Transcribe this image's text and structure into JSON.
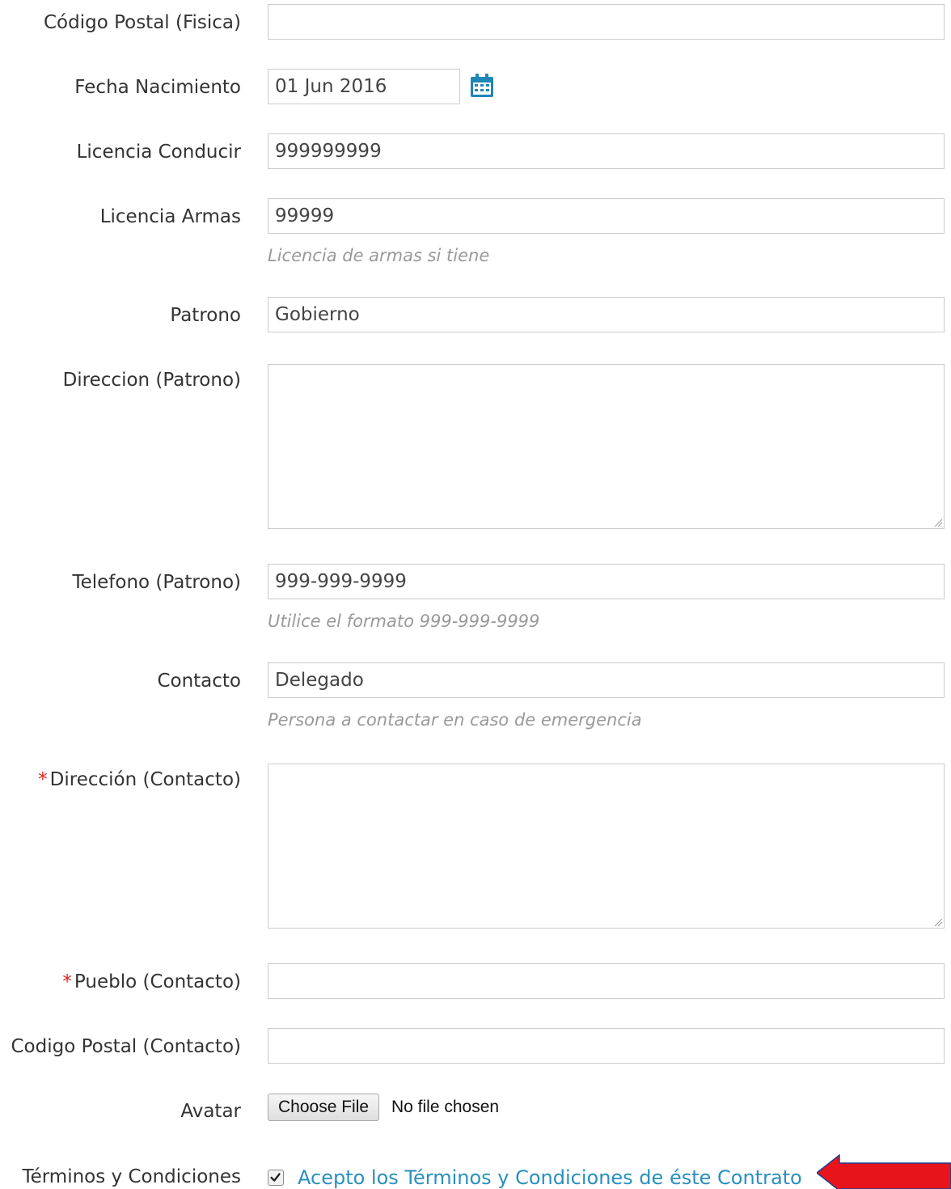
{
  "form": {
    "codigo_postal_fisica": {
      "label": "Código Postal (Fisica)",
      "value": ""
    },
    "fecha_nacimiento": {
      "label": "Fecha Nacimiento",
      "value": "01 Jun 2016",
      "icon": "calendar-icon"
    },
    "licencia_conducir": {
      "label": "Licencia Conducir",
      "value": "999999999"
    },
    "licencia_armas": {
      "label": "Licencia Armas",
      "value": "99999",
      "help": "Licencia de armas si tiene"
    },
    "patrono": {
      "label": "Patrono",
      "value": "Gobierno"
    },
    "direccion_patrono": {
      "label": "Direccion (Patrono)",
      "value": ""
    },
    "telefono_patrono": {
      "label": "Telefono (Patrono)",
      "value": "999-999-9999",
      "help": "Utilice el formato 999-999-9999"
    },
    "contacto": {
      "label": "Contacto",
      "value": "Delegado",
      "help": "Persona a contactar en caso de emergencia"
    },
    "direccion_contacto": {
      "label": "Dirección (Contacto)",
      "required_mark": "*",
      "value": ""
    },
    "pueblo_contacto": {
      "label": "Pueblo (Contacto)",
      "required_mark": "*",
      "value": ""
    },
    "codigo_postal_contacto": {
      "label": "Codigo Postal (Contacto)",
      "value": ""
    },
    "avatar": {
      "label": "Avatar",
      "button_label": "Choose File",
      "status": "No file chosen"
    },
    "terminos": {
      "label": "Términos y Condiciones",
      "checkbox_text": "Acepto los Términos y Condiciones de éste Contrato",
      "checked": true
    }
  },
  "colors": {
    "required": "#e02020",
    "link": "#2a8fbd",
    "help_text": "#999999",
    "calendar_icon": "#1f86b8",
    "arrow": "#e8141b"
  }
}
